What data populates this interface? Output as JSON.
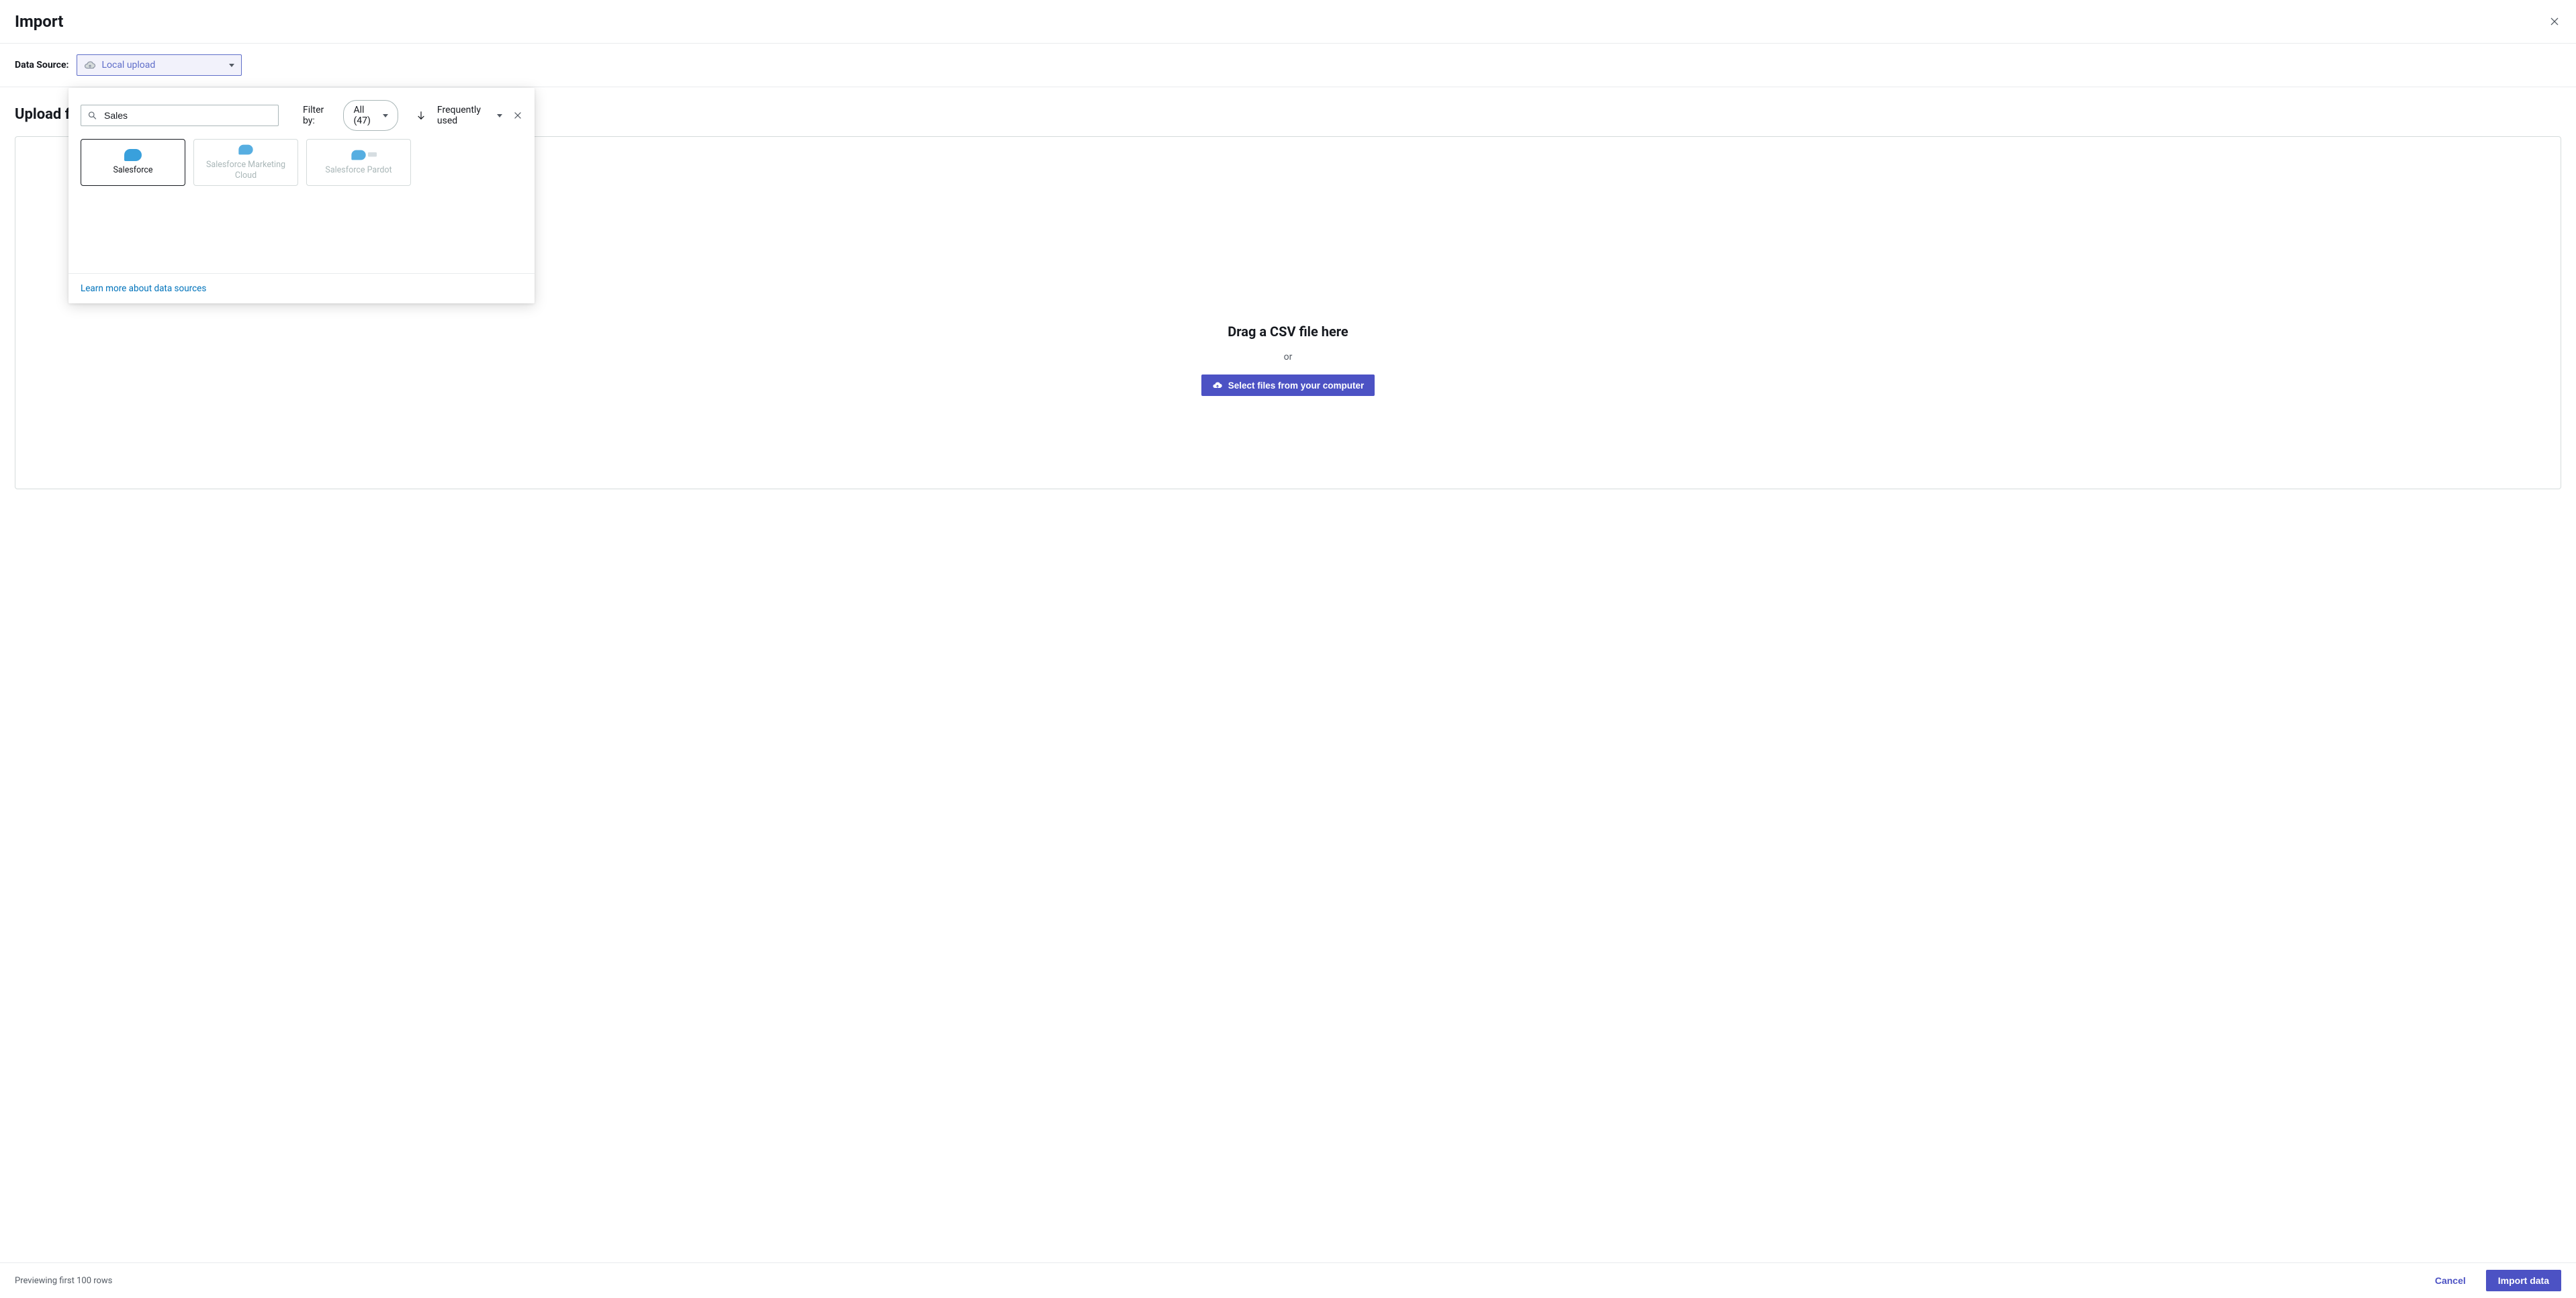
{
  "header": {
    "title": "Import"
  },
  "data_source": {
    "label": "Data Source:",
    "selected": "Local upload"
  },
  "dropdown": {
    "search_value": "Sales",
    "filter_label": "Filter by:",
    "filter_value": "All (47)",
    "sort_value": "Frequently used",
    "cards": [
      {
        "label": "Salesforce",
        "highlight": true
      },
      {
        "label": "Salesforce Marketing Cloud",
        "disabled": true
      },
      {
        "label": "Salesforce Pardot",
        "disabled": true
      }
    ],
    "learn_more": "Learn more about data sources"
  },
  "upload": {
    "section_title": "Upload file",
    "drag_label": "Drag a CSV file here",
    "or_label": "or",
    "select_button": "Select files from your computer"
  },
  "footer": {
    "preview_note": "Previewing first 100 rows",
    "cancel": "Cancel",
    "import": "Import data"
  }
}
